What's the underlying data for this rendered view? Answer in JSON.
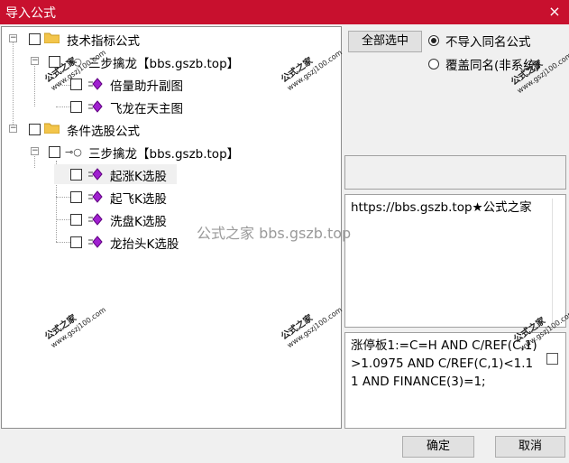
{
  "window": {
    "title": "导入公式",
    "close_glyph": "×"
  },
  "tree": {
    "group1": {
      "label": "技术指标公式"
    },
    "formula1": {
      "label": "三步擒龙【bbs.gszb.top】"
    },
    "f1_items": [
      "倍量助升副图",
      "飞龙在天主图"
    ],
    "group2": {
      "label": "条件选股公式"
    },
    "formula2": {
      "label": "三步擒龙【bbs.gszb.top】"
    },
    "f2_items": [
      "起涨K选股",
      "起飞K选股",
      "洗盘K选股",
      "龙抬头K选股"
    ]
  },
  "controls": {
    "select_all": "全部选中",
    "radio_skip": "不导入同名公式",
    "radio_overwrite": "覆盖同名(非系统)",
    "radio_selected": "radio_skip"
  },
  "desc_text": "https://bbs.gszb.top★公式之家",
  "code_text": "涨停板1:=C=H AND C/REF(C,1)>1.0975 AND C/REF(C,1)<1.11 AND FINANCE(3)=1;",
  "buttons": {
    "ok": "确定",
    "cancel": "取消"
  },
  "watermarks": {
    "stamp_text": "公式之家",
    "stamp_url": "www.gszj100.com",
    "center_text": "公式之家 bbs.gszb.top"
  },
  "colors": {
    "titlebar": "#c8102e",
    "gem": "#a020d0"
  }
}
